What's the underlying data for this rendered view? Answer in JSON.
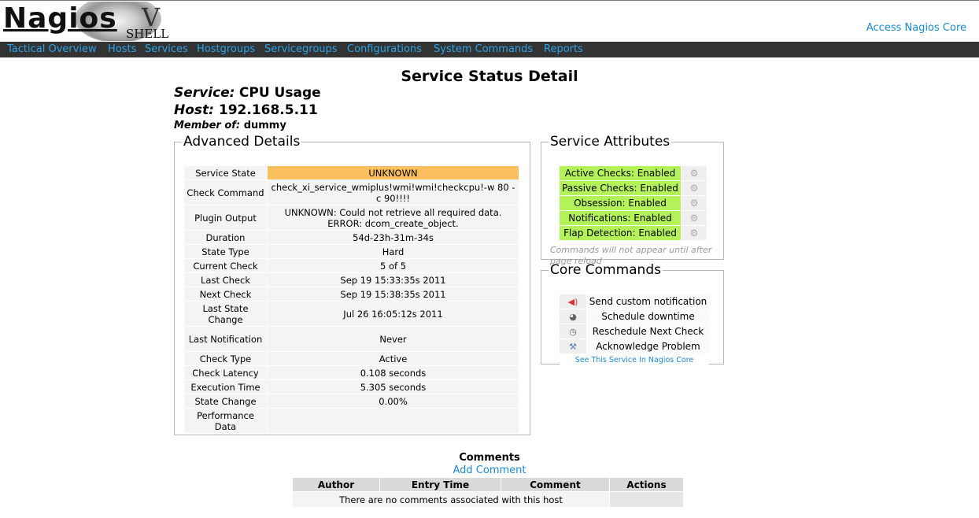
{
  "header": {
    "logo_word": "Nagios",
    "logo_v": "V",
    "logo_shell": "SHELL",
    "access_link": "Access Nagios Core"
  },
  "nav": {
    "items": [
      "Tactical Overview",
      "Hosts",
      "Services",
      "Hostgroups",
      "Servicegroups",
      "Configurations",
      "System Commands",
      "Reports"
    ]
  },
  "page": {
    "title": "Service Status Detail",
    "service_label": "Service:",
    "service_name": "CPU Usage",
    "host_label": "Host:",
    "host_name": "192.168.5.11",
    "member_label": "Member of:",
    "member_name": "dummy"
  },
  "advanced": {
    "legend": "Advanced Details",
    "rows": [
      {
        "label": "Service State",
        "value": "UNKNOWN"
      },
      {
        "label": "Check Command",
        "value": "check_xi_service_wmiplus!wmi!wmi!checkcpu!-w 80 -c 90!!!!"
      },
      {
        "label": "Plugin Output",
        "value": "UNKNOWN: Could not retrieve all required data. ERROR: dcom_create_object."
      },
      {
        "label": "Duration",
        "value": "54d-23h-31m-34s"
      },
      {
        "label": "State Type",
        "value": "Hard"
      },
      {
        "label": "Current Check",
        "value": "5 of 5"
      },
      {
        "label": "Last Check",
        "value": "Sep 19 15:33:35s 2011"
      },
      {
        "label": "Next Check",
        "value": "Sep 19 15:38:35s 2011"
      },
      {
        "label": "Last State Change",
        "value": "Jul 26 16:05:12s 2011"
      },
      {
        "label": "Last Notification",
        "value": "Never"
      },
      {
        "label": "Check Type",
        "value": "Active"
      },
      {
        "label": "Check Latency",
        "value": "0.108 seconds"
      },
      {
        "label": "Execution Time",
        "value": "5.305 seconds"
      },
      {
        "label": "State Change",
        "value": "0.00%"
      },
      {
        "label": "Performance Data",
        "value": ""
      }
    ],
    "state_color": "#fbbf5d"
  },
  "attributes": {
    "legend": "Service Attributes",
    "items": [
      "Active Checks: Enabled",
      "Passive Checks: Enabled",
      "Obsession: Enabled",
      "Notifications: Enabled",
      "Flap Detection: Enabled"
    ],
    "enabled_color": "#b3f259",
    "note": "Commands will not appear until after page reload"
  },
  "core": {
    "legend": "Core Commands",
    "commands": [
      {
        "label": "Send custom notification",
        "icon": "megaphone-icon"
      },
      {
        "label": "Schedule downtime",
        "icon": "downtime-icon"
      },
      {
        "label": "Reschedule Next Check",
        "icon": "clock-icon"
      },
      {
        "label": "Acknowledge Problem",
        "icon": "wrench-icon"
      }
    ],
    "link": "See This Service In Nagios Core"
  },
  "comments": {
    "title": "Comments",
    "add": "Add Comment",
    "headers": [
      "Author",
      "Entry Time",
      "Comment",
      "Actions"
    ],
    "empty": "There are no comments associated with this host"
  }
}
